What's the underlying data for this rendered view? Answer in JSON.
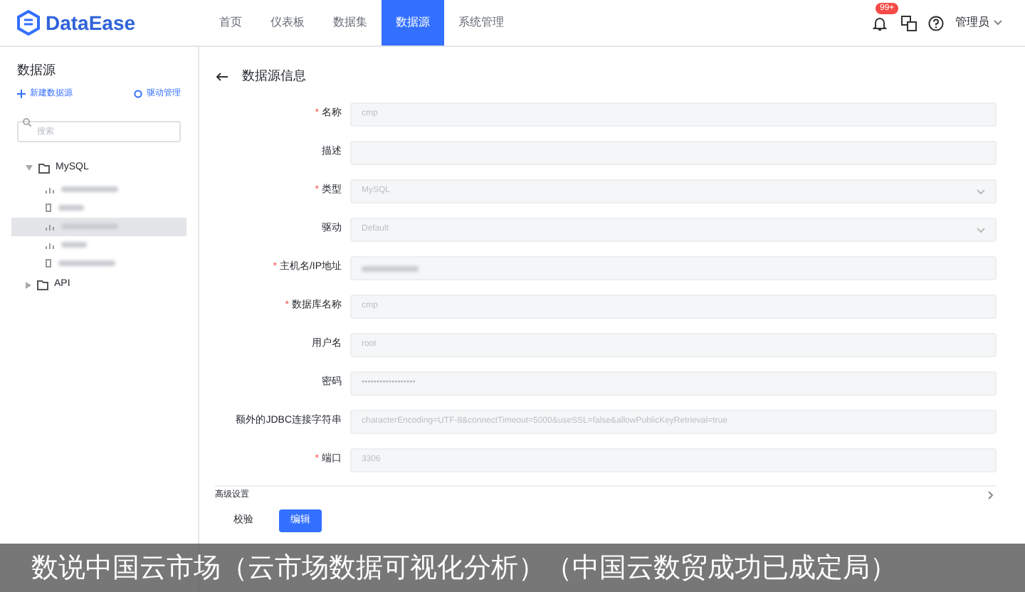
{
  "header": {
    "logo": "DataEase",
    "nav": [
      {
        "label": "首页",
        "selected": false
      },
      {
        "label": "仪表板",
        "selected": false
      },
      {
        "label": "数据集",
        "selected": false
      },
      {
        "label": "数据源",
        "selected": true
      },
      {
        "label": "系统管理",
        "selected": false
      }
    ],
    "badge": "99+",
    "user": "管理员"
  },
  "sidebar": {
    "title": "数据源",
    "new_button": "新建数据源",
    "driver_button": "驱动管理",
    "search": {
      "placeholder": "搜索"
    },
    "tree": [
      {
        "label": "MySQL",
        "expanded": true,
        "children": [
          {
            "kind": "chart",
            "selected": false
          },
          {
            "kind": "file",
            "selected": false
          },
          {
            "kind": "chart",
            "selected": true
          },
          {
            "kind": "chart",
            "selected": false
          },
          {
            "kind": "file",
            "selected": false
          }
        ]
      },
      {
        "label": "API",
        "expanded": false
      }
    ]
  },
  "form": {
    "title": "数据源信息",
    "required_mark": "*",
    "fields": [
      {
        "label": "名称",
        "required": true,
        "kind": "input",
        "value": "cmp"
      },
      {
        "label": "描述",
        "required": false,
        "kind": "input"
      },
      {
        "label": "类型",
        "required": true,
        "kind": "select",
        "value": "MySQL"
      },
      {
        "label": "驱动",
        "required": false,
        "kind": "select",
        "value": "Default"
      },
      {
        "label": "主机名/IP地址",
        "required": true,
        "kind": "input",
        "blurred": true
      },
      {
        "label": "数据库名称",
        "required": true,
        "kind": "input",
        "value": "cmp"
      },
      {
        "label": "用户名",
        "required": false,
        "kind": "input",
        "value": "root"
      },
      {
        "label": "密码",
        "required": false,
        "kind": "input",
        "value": "••••••••••••••••••"
      },
      {
        "label": "额外的JDBC连接字符串",
        "required": false,
        "kind": "input",
        "value": "characterEncoding=UTF-8&connectTimeout=5000&useSSL=false&allowPublicKeyRetrieval=true"
      },
      {
        "label": "端口",
        "required": true,
        "kind": "input",
        "value": "3306"
      }
    ],
    "advanced": "高级设置",
    "buttons": [
      {
        "label": "校验",
        "kind": "secondary"
      },
      {
        "label": "编辑",
        "kind": "primary"
      }
    ]
  },
  "caption": "数说中国云市场（云市场数据可视化分析）（中国云数贸成功已成定局）"
}
